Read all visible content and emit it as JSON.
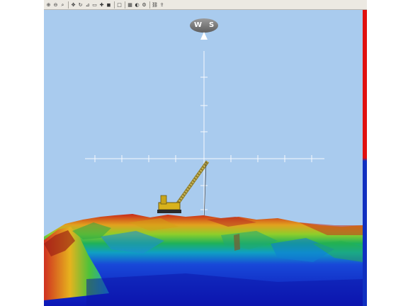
{
  "toolbar": {
    "buttons": [
      {
        "name": "zoom-in-icon",
        "glyph": "⊕"
      },
      {
        "name": "zoom-out-icon",
        "glyph": "⊖"
      },
      {
        "name": "zoom-window-icon",
        "glyph": "⌕"
      },
      {
        "name": "pan-icon",
        "glyph": "✥"
      },
      {
        "name": "rotate-icon",
        "glyph": "↻"
      },
      {
        "name": "measure-icon",
        "glyph": "⊿"
      },
      {
        "name": "save-view-icon",
        "glyph": "▭"
      },
      {
        "name": "crosshair-icon",
        "glyph": "✚"
      },
      {
        "name": "layer-icon",
        "glyph": "◼"
      },
      {
        "name": "box-icon",
        "glyph": "□"
      },
      {
        "name": "grid-icon",
        "glyph": "▦"
      },
      {
        "name": "color-map-icon",
        "glyph": "◐"
      },
      {
        "name": "settings-icon",
        "glyph": "⚙"
      },
      {
        "name": "link-icon",
        "glyph": "⛓"
      },
      {
        "name": "export-icon",
        "glyph": "⇪"
      }
    ]
  },
  "compass": {
    "west": "W",
    "south": "S"
  },
  "colors": {
    "sky": "#a9cbee",
    "crane_boom": "#b8a340",
    "crane_body": "#d8b21c",
    "scale_high": "#e01010",
    "scale_low": "#1030c0"
  }
}
